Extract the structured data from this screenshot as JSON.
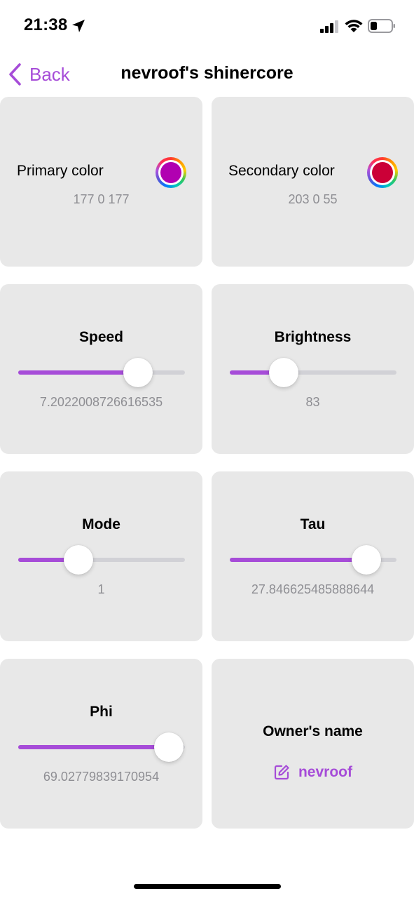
{
  "status_bar": {
    "time": "21:38"
  },
  "nav": {
    "back_label": "Back",
    "title": "nevroof's shinercore"
  },
  "colors": {
    "accent": "#a64cd8",
    "primary": {
      "label": "Primary color",
      "value": "177 0 177",
      "swatch": "#b100b1"
    },
    "secondary": {
      "label": "Secondary color",
      "value": "203 0 55",
      "swatch": "#cb0037"
    }
  },
  "sliders": {
    "speed": {
      "label": "Speed",
      "value": "7.2022008726616535",
      "fill": 0.72
    },
    "brightness": {
      "label": "Brightness",
      "value": "83",
      "fill": 0.325
    },
    "mode": {
      "label": "Mode",
      "value": "1",
      "fill": 0.36
    },
    "tau": {
      "label": "Tau",
      "value": "27.846625485888644",
      "fill": 0.82
    },
    "phi": {
      "label": "Phi",
      "value": "69.02779839170954",
      "fill": 0.905
    }
  },
  "owner": {
    "label": "Owner's name",
    "name": "nevroof"
  }
}
